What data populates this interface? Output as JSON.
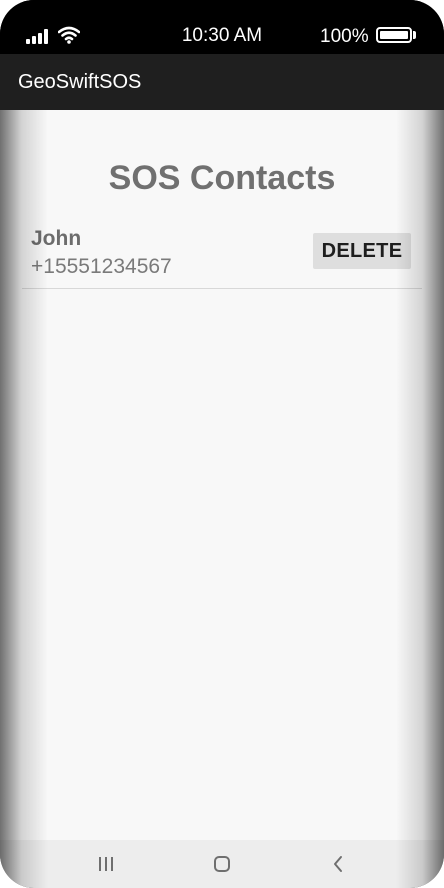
{
  "status_bar": {
    "time": "10:30 AM",
    "battery_percent": "100%",
    "icons": [
      "signal-icon",
      "wifi-icon",
      "battery-icon"
    ]
  },
  "app_bar": {
    "title": "GeoSwiftSOS"
  },
  "main": {
    "title": "SOS Contacts",
    "contacts": [
      {
        "name": "John",
        "phone": "+15551234567",
        "delete_label": "DELETE"
      }
    ]
  },
  "nav_bar": {
    "icons": [
      "recent-apps-icon",
      "home-icon",
      "back-icon"
    ]
  },
  "colors": {
    "app_bar": "#1f1f1f",
    "content_bg": "#f8f8f8",
    "title_text": "#707070",
    "button_bg": "#dedede"
  }
}
